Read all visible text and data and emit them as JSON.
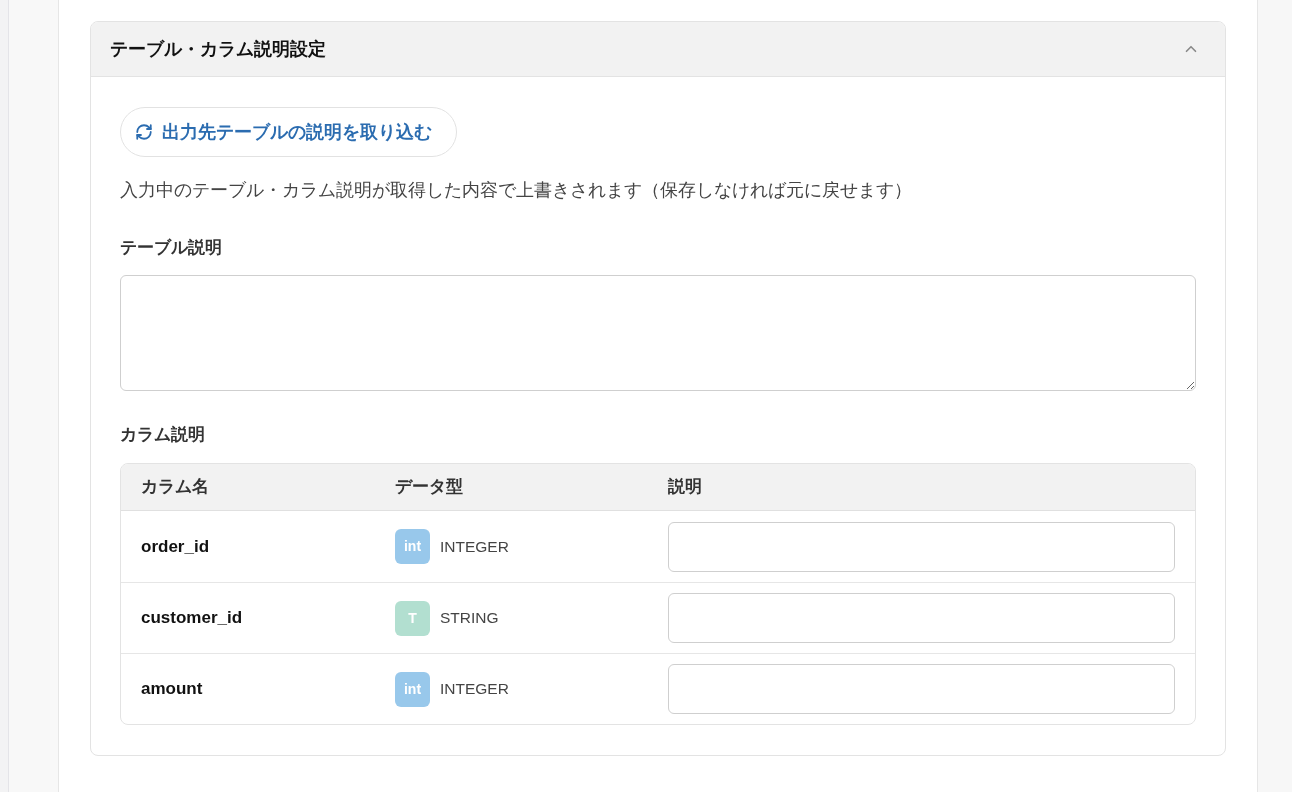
{
  "panel": {
    "title": "テーブル・カラム説明設定",
    "expanded": true
  },
  "import_button": {
    "label": "出力先テーブルの説明を取り込む"
  },
  "note": "入力中のテーブル・カラム説明が取得した内容で上書きされます（保存しなければ元に戻せます）",
  "table_description": {
    "label": "テーブル説明"
  },
  "column_descriptions": {
    "label": "カラム説明",
    "columns": [
      "カラム名",
      "データ型",
      "説明"
    ],
    "rows": [
      {
        "name": "order_id",
        "badge": "int",
        "color": "#98c8eb",
        "type": "INTEGER"
      },
      {
        "name": "customer_id",
        "badge": "T",
        "color": "#b2dfd0",
        "type": "STRING"
      },
      {
        "name": "amount",
        "badge": "int",
        "color": "#98c8eb",
        "type": "INTEGER"
      }
    ]
  }
}
